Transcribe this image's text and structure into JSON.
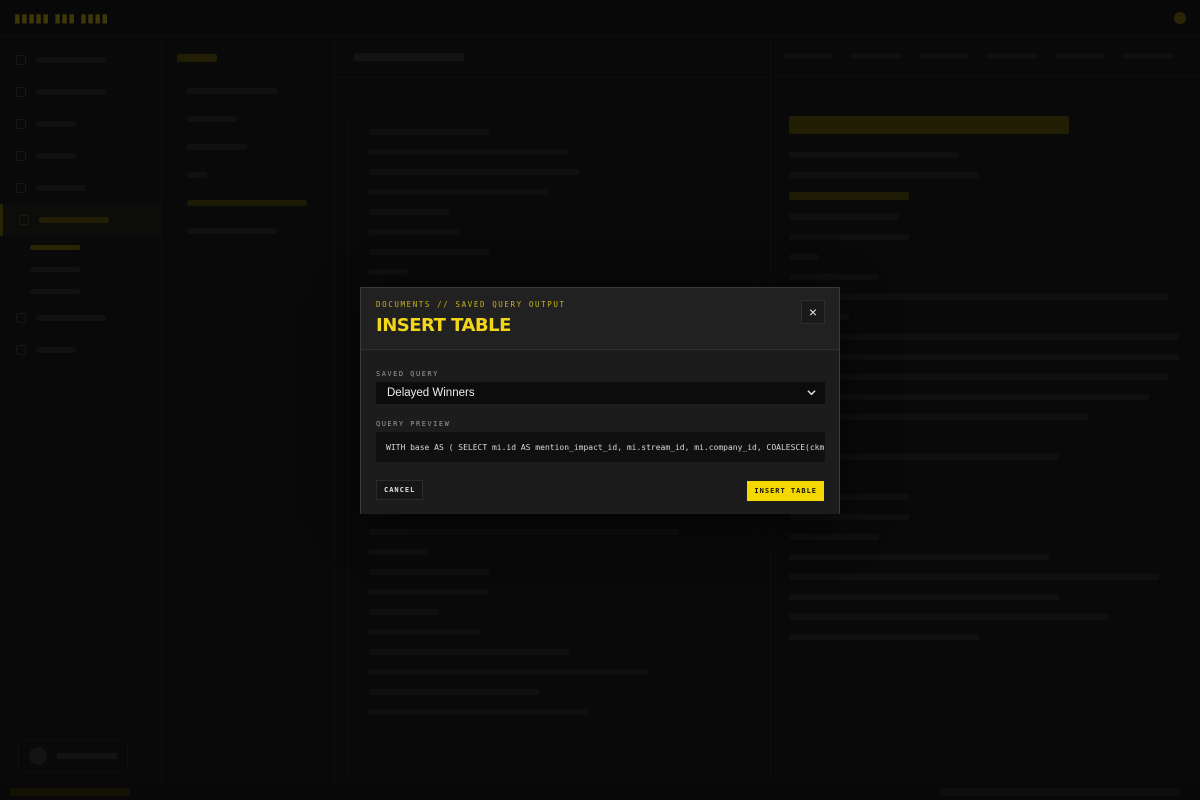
{
  "modal": {
    "eyebrow": "DOCUMENTS // SAVED QUERY OUTPUT",
    "title": "INSERT TABLE",
    "close_label": "×",
    "saved_query_label": "SAVED QUERY",
    "saved_query_value": "Delayed Winners",
    "query_preview_label": "QUERY PREVIEW",
    "query_preview_text": "WITH base AS ( SELECT mi.id AS mention_impact_id, mi.stream_id, mi.company_id, COALESCE(ckm.k…",
    "cancel_label": "CANCEL",
    "insert_label": "INSERT TABLE"
  },
  "colors": {
    "accent": "#f5d800",
    "background": "#161616",
    "modal_bg": "#1f1f1f"
  }
}
